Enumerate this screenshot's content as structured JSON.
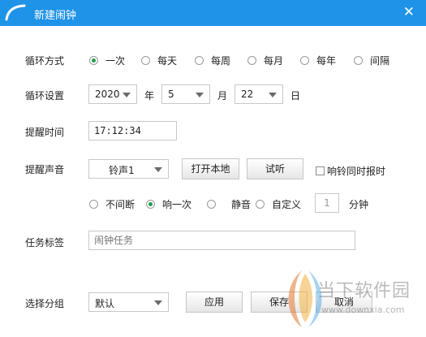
{
  "window": {
    "title": "新建闹钟",
    "close_symbol": "✕"
  },
  "loop_mode": {
    "label": "循环方式",
    "options": [
      "一次",
      "每天",
      "每周",
      "每月",
      "每年",
      "间隔"
    ],
    "selected": "一次"
  },
  "loop_settings": {
    "label": "循环设置",
    "year": "2020",
    "year_unit": "年",
    "month": "5",
    "month_unit": "月",
    "day": "22",
    "day_unit": "日"
  },
  "remind_time": {
    "label": "提醒时间",
    "value": "17:12:34"
  },
  "remind_sound": {
    "label": "提醒声音",
    "sound": "铃声1",
    "open_local": "打开本地",
    "preview": "试听",
    "announce_time": "响铃同时报时",
    "modes": [
      "不间断",
      "响一次",
      "静音",
      "自定义"
    ],
    "selected_mode": "响一次",
    "custom_value": "1",
    "custom_unit": "分钟"
  },
  "task_tag": {
    "label": "任务标签",
    "placeholder": "闹钟任务"
  },
  "group": {
    "label": "选择分组",
    "value": "默认",
    "apply": "应用",
    "save": "保存",
    "cancel": "取消"
  },
  "watermark": {
    "cn": "当下软件园",
    "url": "www.downxia.com"
  },
  "colors": {
    "titlebar": "#1f93e8",
    "radio_selected": "#22a04b"
  }
}
